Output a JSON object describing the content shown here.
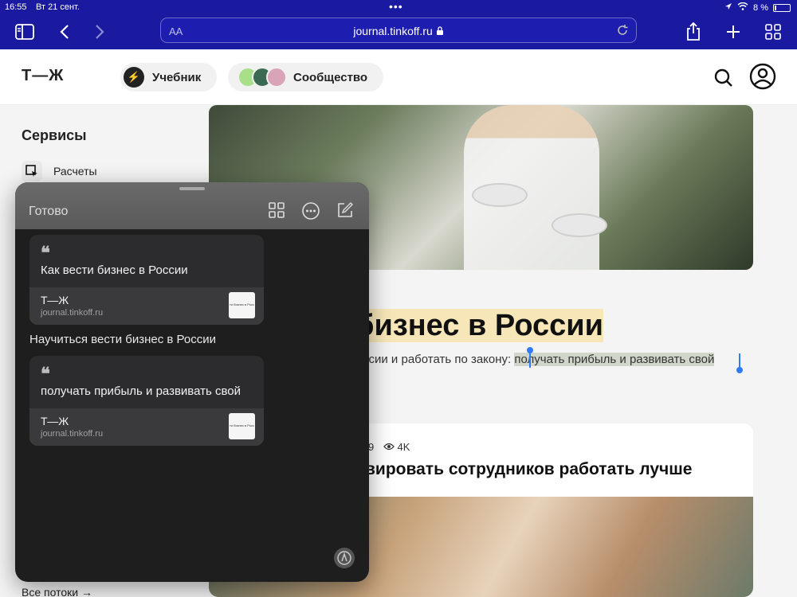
{
  "status_bar": {
    "time": "16:55",
    "date": "Вт 21 сент.",
    "dots": "•••",
    "battery": "8 %"
  },
  "safari": {
    "text_size_label": "AA",
    "url": "journal.tinkoff.ru",
    "icons": [
      "sidebar-icon",
      "back-icon",
      "forward-icon",
      "lock-icon",
      "reload-icon",
      "share-icon",
      "new-tab-icon",
      "tabs-overview-icon"
    ]
  },
  "site_header": {
    "logo": "Т—Ж",
    "learn_label": "Учебник",
    "community_label": "Сообщество"
  },
  "sidebar": {
    "title": "Сервисы",
    "items": [
      {
        "label": "Расчеты"
      }
    ],
    "all_streams": "Все потоки →"
  },
  "article": {
    "title_visible": "бизнес в России",
    "subtitle_before": "ссии и работать по закону: ",
    "subtitle_selected": "получать прибыль и развивать свой"
  },
  "card": {
    "meta_comments": "9",
    "meta_views": "4K",
    "title": "вировать сотрудников работать лучше"
  },
  "quick_note": {
    "done_label": "Готово",
    "links": [
      {
        "quote_mark": "❝",
        "text": "Как вести бизнес в России",
        "site": "Т—Ж",
        "domain": "journal.tinkoff.ru",
        "thumb_text": "ти бизнес в Росс"
      },
      {
        "quote_mark": "❝",
        "text": "получать прибыль и развивать свой",
        "site": "Т—Ж",
        "domain": "journal.tinkoff.ru",
        "thumb_text": "ти бизнес в Росс"
      }
    ],
    "note_text": "Научиться вести бизнес в России"
  },
  "colors": {
    "safari_bar": "#1a1aa0",
    "highlight": "#f7e7b8",
    "selection": "#d0d6c9",
    "selection_handle": "#2f7bf5",
    "quick_note_bg": "#1e1e1e"
  }
}
